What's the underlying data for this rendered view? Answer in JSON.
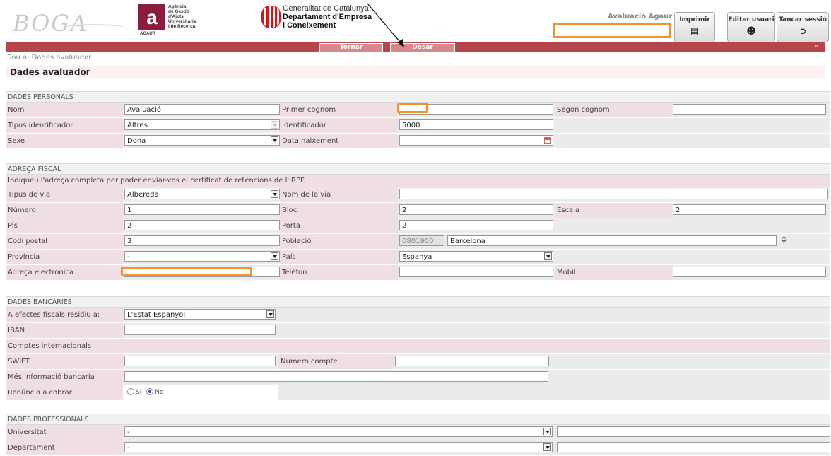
{
  "header": {
    "logo_boga": "BOGA",
    "agaur_letter": "a",
    "agaur_lines": [
      "Agència",
      "de Gestió",
      "d'Ajuts",
      "Universitaris",
      "i de Recerca"
    ],
    "agaur_small": "AGAUR",
    "gencat_line1": "Generalitat de Catalunya",
    "gencat_line2": "Departament d'Empresa",
    "gencat_line3": "i Coneixement",
    "user_name": "Avaluació Agaur",
    "buttons": {
      "print": "Imprimir",
      "edit_user": "Editar usuari",
      "logout": "Tancar sessió"
    }
  },
  "toolbar": {
    "back": "Tornar",
    "save": "Desar"
  },
  "breadcrumb": "Sou a: Dades avaluador",
  "page_title": "Dades avaluador",
  "personal": {
    "title": "DADES PERSONALS",
    "nom_label": "Nom",
    "nom_value": "Avaluació",
    "cognom1_label": "Primer cognom",
    "cognom1_value": "",
    "cognom2_label": "Segon cognom",
    "cognom2_value": "",
    "tipus_id_label": "Tipus identificador",
    "tipus_id_value": "Altres",
    "identificador_label": "Identificador",
    "identificador_value": "5000",
    "sexe_label": "Sexe",
    "sexe_value": "Dona",
    "naixement_label": "Data naixement",
    "naixement_value": ""
  },
  "fiscal": {
    "title": "ADREÇA FISCAL",
    "note": "Indiqueu l'adreça completa per poder enviar-vos el certificat de retencions de l'IRPF.",
    "tipus_via_label": "Tipus de via",
    "tipus_via_value": "Albereda",
    "nom_via_label": "Nom de la via",
    "nom_via_value": ".",
    "numero_label": "Número",
    "numero_value": "1",
    "bloc_label": "Bloc",
    "bloc_value": "2",
    "escala_label": "Escala",
    "escala_value": "2",
    "pis_label": "Pis",
    "pis_value": "2",
    "porta_label": "Porta",
    "porta_value": "2",
    "cp_label": "Codi postal",
    "cp_value": "3",
    "poblacio_label": "Població",
    "poblacio_code": "0801900",
    "poblacio_value": "Barcelona",
    "provincia_label": "Província",
    "provincia_value": "-",
    "pais_label": "País",
    "pais_value": "Espanya",
    "email_label": "Adreça electrònica",
    "email_value": "",
    "telefon_label": "Telèfon",
    "telefon_value": "",
    "mobil_label": "Mòbil",
    "mobil_value": ""
  },
  "bank": {
    "title": "DADES BANCÀRIES",
    "residence_label": "A efectes fiscals residiu a:",
    "residence_value": "L'Estat Espanyol",
    "iban_label": "IBAN",
    "iban_value": "",
    "intl_label": "Comptes internacionals",
    "swift_label": "SWIFT",
    "swift_value": "",
    "account_label": "Número compte",
    "account_value": "",
    "more_label": "Més informació bancaria",
    "more_value": "",
    "renounce_label": "Renúncia a cobrar",
    "yes": "Sí",
    "no": "No"
  },
  "professional": {
    "title": "DADES PROFESSIONALS",
    "univ_label": "Universitat",
    "univ_value": "-",
    "dept_label": "Departament",
    "dept_value": "-"
  },
  "colors": {
    "brand_red": "#b5464b",
    "label_bg": "#efdfe3",
    "highlight_orange": "#f3922f"
  },
  "icons": {
    "print": "printer-icon",
    "edit_user": "user-edit-icon",
    "logout": "logout-icon",
    "calendar": "calendar-icon",
    "search": "search-icon"
  }
}
